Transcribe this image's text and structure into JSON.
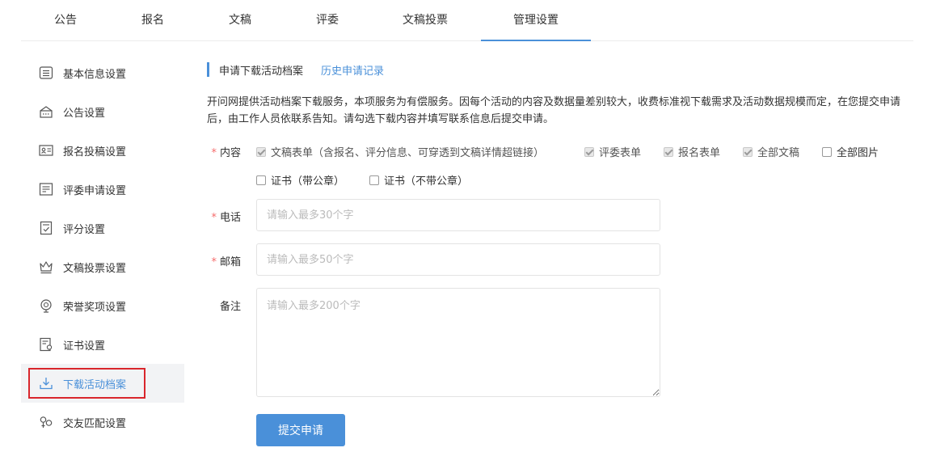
{
  "tabs": [
    {
      "label": "公告"
    },
    {
      "label": "报名"
    },
    {
      "label": "文稿"
    },
    {
      "label": "评委"
    },
    {
      "label": "文稿投票"
    },
    {
      "label": "管理设置",
      "active": true
    }
  ],
  "sidebar": {
    "items": [
      {
        "label": "基本信息设置",
        "icon": "list-icon"
      },
      {
        "label": "公告设置",
        "icon": "announcement-icon"
      },
      {
        "label": "报名投稿设置",
        "icon": "id-card-icon"
      },
      {
        "label": "评委申请设置",
        "icon": "form-icon"
      },
      {
        "label": "评分设置",
        "icon": "rating-icon"
      },
      {
        "label": "文稿投票设置",
        "icon": "crown-icon"
      },
      {
        "label": "荣誉奖项设置",
        "icon": "medal-icon"
      },
      {
        "label": "证书设置",
        "icon": "certificate-icon"
      },
      {
        "label": "下载活动档案",
        "icon": "download-icon",
        "active": true
      },
      {
        "label": "交友匹配设置",
        "icon": "match-icon"
      }
    ]
  },
  "subnav": {
    "current": "申请下载活动档案",
    "history": "历史申请记录"
  },
  "description": "开问网提供活动档案下载服务，本项服务为有偿服务。因每个活动的内容及数据量差别较大，收费标准视下载需求及活动数据规模而定，在您提交申请后，由工作人员依联系告知。请勾选下载内容并填写联系信息后提交申请。",
  "form": {
    "content_label": "内容",
    "content_options": [
      {
        "label": "文稿表单（含报名、评分信息、可穿透到文稿详情超链接）",
        "checked": true,
        "disabled": true
      },
      {
        "label": "评委表单",
        "checked": true,
        "disabled": true
      },
      {
        "label": "报名表单",
        "checked": true,
        "disabled": true
      },
      {
        "label": "全部文稿",
        "checked": true,
        "disabled": true
      },
      {
        "label": "全部图片",
        "checked": false,
        "disabled": false
      },
      {
        "label": "证书（带公章）",
        "checked": false,
        "disabled": false
      },
      {
        "label": "证书（不带公章）",
        "checked": false,
        "disabled": false
      }
    ],
    "phone_label": "电话",
    "phone_placeholder": "请输入最多30个字",
    "email_label": "邮箱",
    "email_placeholder": "请输入最多50个字",
    "remark_label": "备注",
    "remark_placeholder": "请输入最多200个字",
    "submit_label": "提交申请"
  },
  "colors": {
    "accent": "#4a90d9",
    "required": "#f56c6c",
    "highlight": "#d9262c"
  }
}
